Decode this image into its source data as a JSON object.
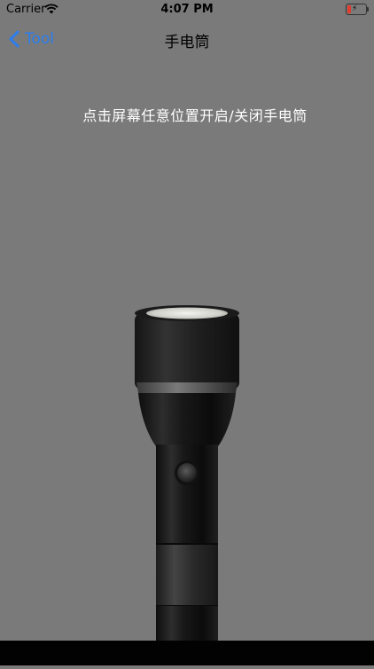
{
  "status_bar": {
    "carrier": "Carrier",
    "time": "4:07 PM",
    "battery_level_percent": 15,
    "battery_color": "#e23b2e"
  },
  "nav": {
    "back_label": "Tool",
    "title": "手电筒",
    "accent_color": "#2a7ef0"
  },
  "main": {
    "hint": "点击屏幕任意位置开启/关闭手电筒",
    "flashlight_state": "off",
    "background_color": "#7a7a7a"
  },
  "icons": {
    "wifi": "wifi-icon",
    "battery": "battery-icon",
    "charging": "lightning-bolt-icon",
    "back": "chevron-left-icon",
    "flashlight": "flashlight-icon"
  }
}
